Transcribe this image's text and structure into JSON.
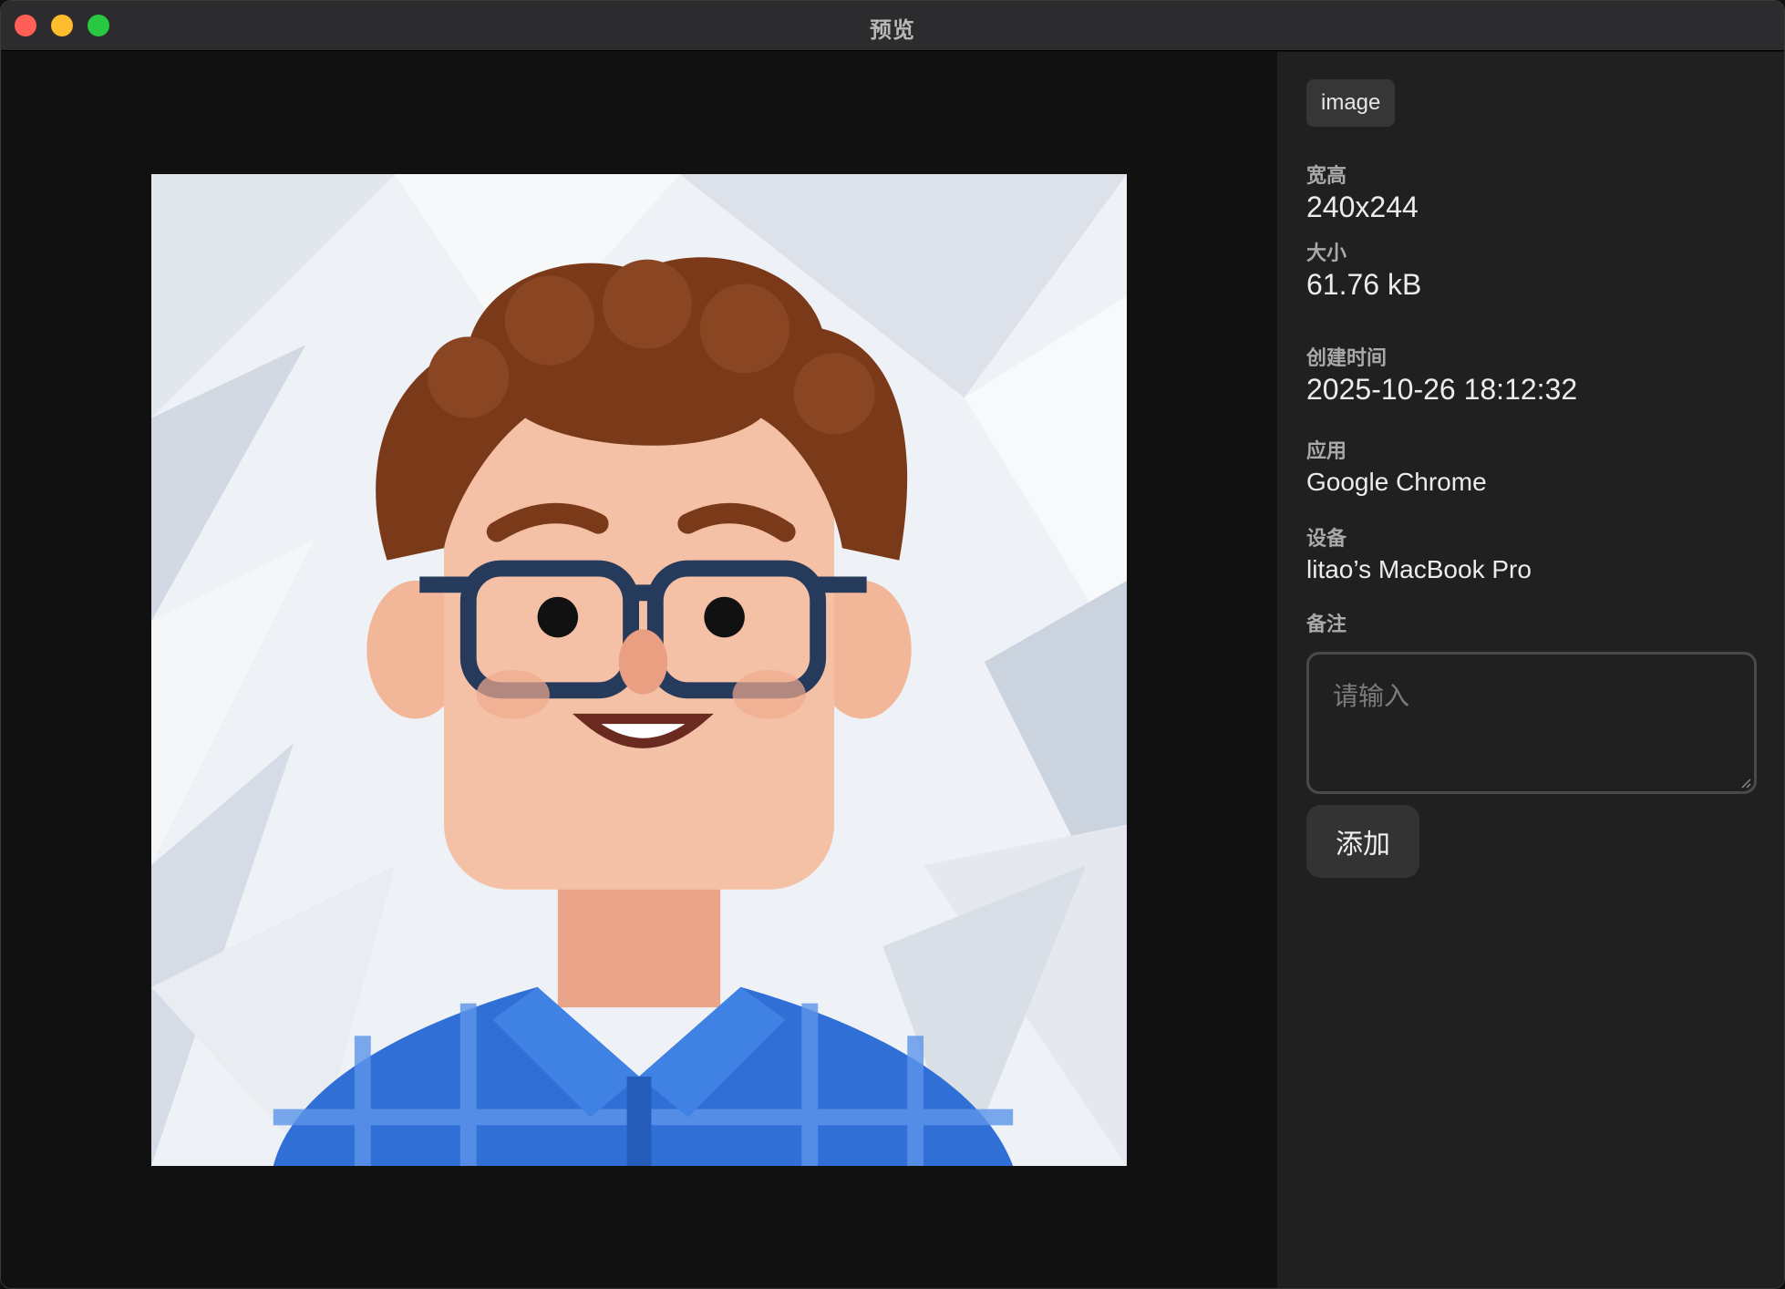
{
  "window": {
    "title": "预览"
  },
  "panel": {
    "type_tag": "image",
    "dimensions": {
      "label": "宽高",
      "value": "240x244"
    },
    "size": {
      "label": "大小",
      "value": "61.76 kB"
    },
    "created": {
      "label": "创建时间",
      "value": "2025-10-26 18:12:32"
    },
    "app": {
      "label": "应用",
      "value": "Google Chrome"
    },
    "device": {
      "label": "设备",
      "value": "litao’s MacBook Pro"
    },
    "notes": {
      "label": "备注",
      "placeholder": "请输入",
      "value": ""
    },
    "add_button": "添加"
  },
  "preview": {
    "image_subject": "cartoon-avatar-portrait"
  }
}
